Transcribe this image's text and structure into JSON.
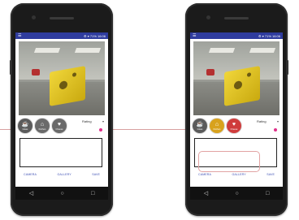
{
  "screens": [
    {
      "id": "left",
      "status": {
        "left": "☰",
        "right": "⚙ ▾ 71% 16:06"
      },
      "buttons": [
        {
          "name": "glass",
          "glyph": "☕",
          "caption": "Glass",
          "color": "#5b5b5b"
        },
        {
          "name": "kitchen",
          "glyph": "⌂",
          "caption": "Kitchen",
          "color": "#6a6a6a"
        },
        {
          "name": "heart",
          "glyph": "♥",
          "caption": "Cheese",
          "color": "#6a6a6a"
        }
      ],
      "rating_label": "Rating",
      "bottom": {
        "camera": "CAMERA",
        "gallery": "GALLERY",
        "save": "SAVE"
      }
    },
    {
      "id": "right",
      "status": {
        "left": "☰",
        "right": "⚙ ▾ 71% 16:06"
      },
      "buttons": [
        {
          "name": "glass",
          "glyph": "☕",
          "caption": "Glass",
          "color": "#5b5b5b"
        },
        {
          "name": "kitchen",
          "glyph": "⌂",
          "caption": "Kitchen",
          "color": "#d8a21d"
        },
        {
          "name": "heart",
          "glyph": "♥",
          "caption": "Cheese",
          "color": "#cf3c3c"
        }
      ],
      "rating_label": "Rating",
      "bottom": {
        "camera": "CAMERA",
        "gallery": "GALLERY",
        "save": "SAVE"
      }
    }
  ],
  "navbar": {
    "back": "◁",
    "home": "○",
    "recent": "□"
  }
}
